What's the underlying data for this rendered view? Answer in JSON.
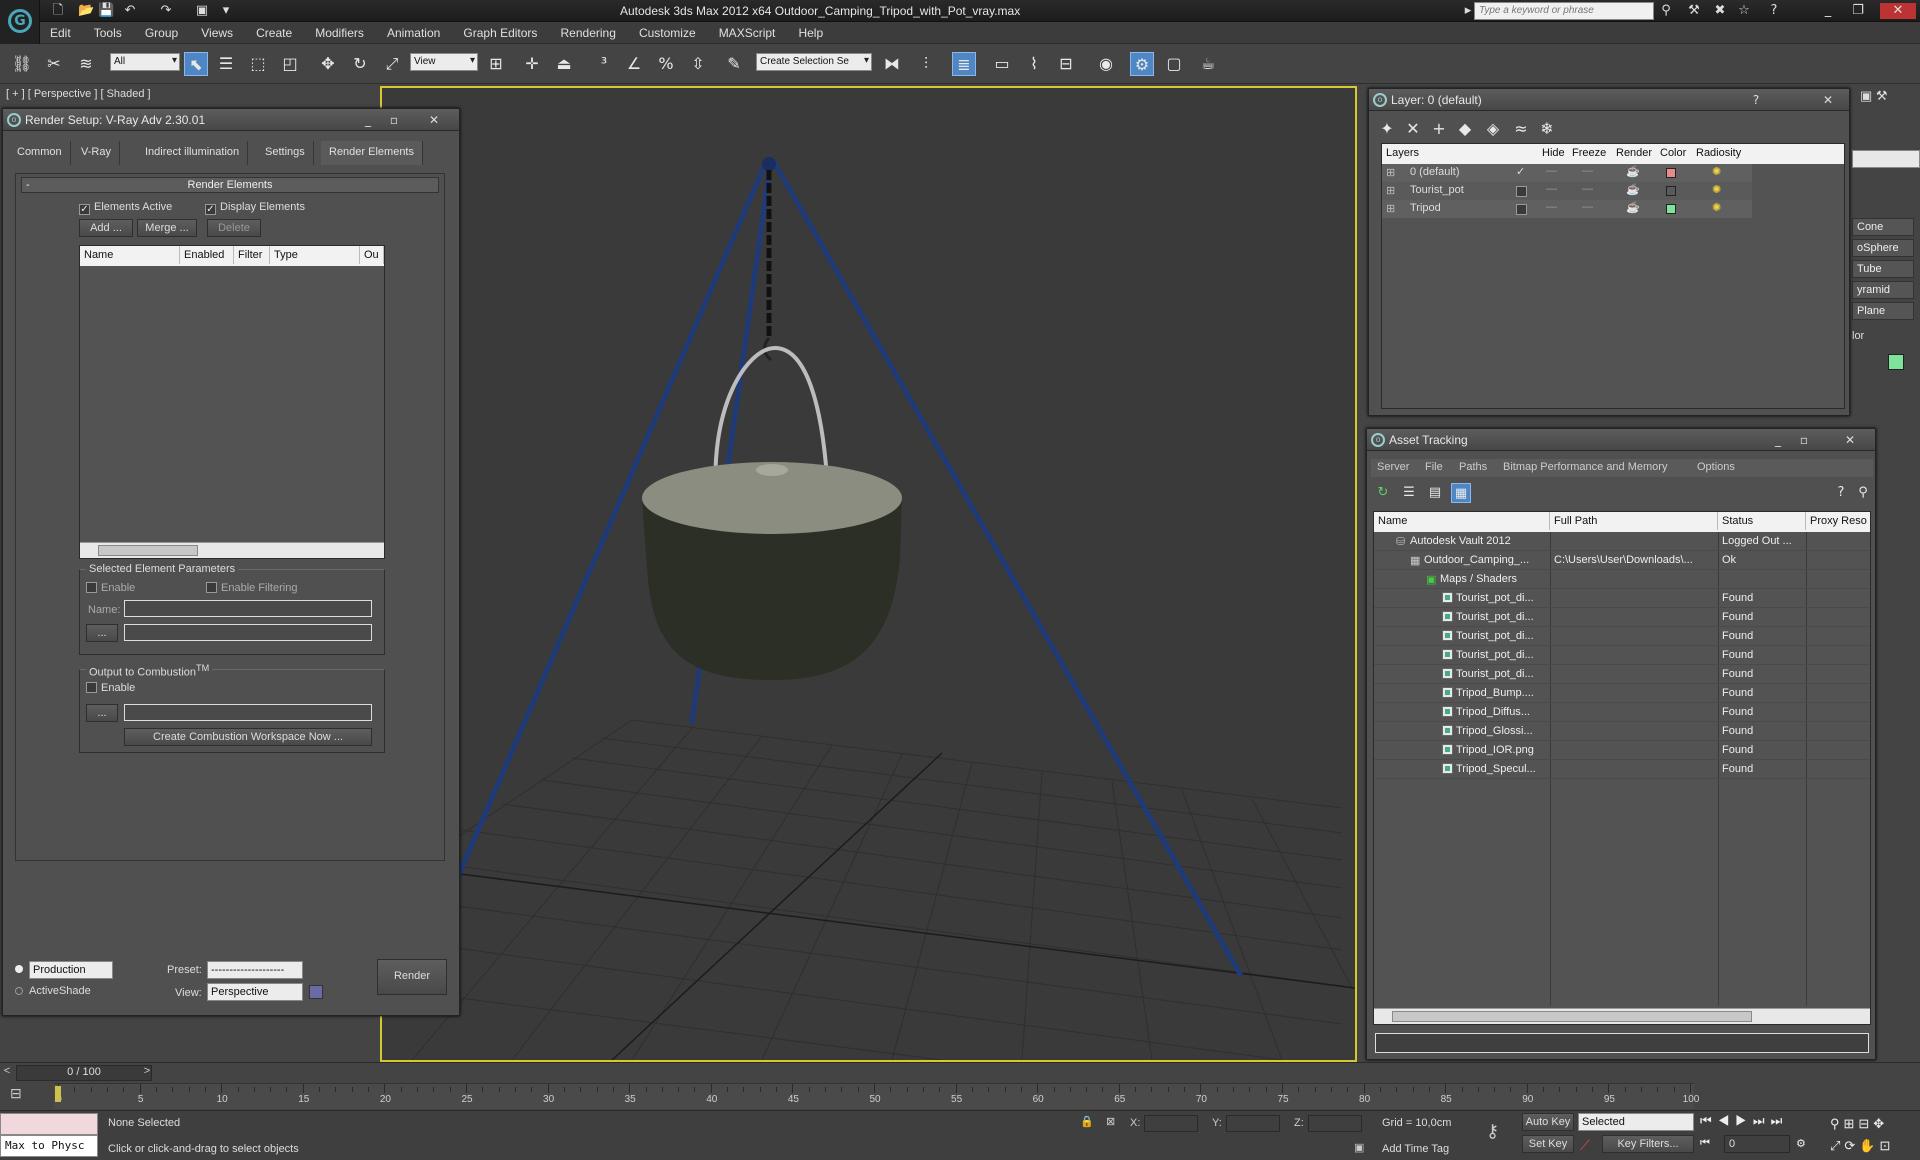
{
  "app": {
    "title": "Autodesk 3ds Max  2012 x64      Outdoor_Camping_Tripod_with_Pot_vray.max",
    "search_placeholder": "Type a keyword or phrase"
  },
  "menu": [
    "Edit",
    "Tools",
    "Group",
    "Views",
    "Create",
    "Modifiers",
    "Animation",
    "Graph Editors",
    "Rendering",
    "Customize",
    "MAXScript",
    "Help"
  ],
  "toolbar": {
    "selection_filter": "All",
    "ref_coord": "View",
    "named_selection": "Create Selection Se"
  },
  "viewport": {
    "label": "[ + ] [ Perspective ] [ Shaded ]"
  },
  "render_setup": {
    "title": "Render Setup: V-Ray Adv 2.30.01",
    "tabs": [
      "Common",
      "V-Ray",
      "Indirect illumination",
      "Settings",
      "Render Elements"
    ],
    "rollout": "Render Elements",
    "elements_active": "Elements Active",
    "display_elements": "Display Elements",
    "add": "Add ...",
    "merge": "Merge ...",
    "delete": "Delete",
    "columns": [
      "Name",
      "Enabled",
      "Filter",
      "Type",
      "Ou"
    ],
    "sel_params": "Selected Element Parameters",
    "enable": "Enable",
    "enable_filtering": "Enable Filtering",
    "name_label": "Name:",
    "dots": "...",
    "combustion": "Output to Combustion",
    "combustion_tm": "TM",
    "combustion_enable": "Enable",
    "create_workspace": "Create Combustion Workspace Now ...",
    "mode": "Production",
    "activeshade": "ActiveShade",
    "preset_label": "Preset:",
    "preset_value": "--------------------",
    "view_label": "View:",
    "view_value": "Perspective",
    "render_btn": "Render"
  },
  "layer": {
    "title": "Layer: 0 (default)",
    "columns": [
      "Layers",
      "Hide",
      "Freeze",
      "Render",
      "Color",
      "Radiosity"
    ],
    "rows": [
      {
        "name": "0 (default)",
        "current": "✓",
        "color": "#e88a8a"
      },
      {
        "name": "Tourist_pot",
        "current": "",
        "color": "#5a5a5a"
      },
      {
        "name": "Tripod",
        "current": "",
        "color": "#7ee39a"
      }
    ]
  },
  "asset": {
    "title": "Asset Tracking",
    "menu": [
      "Server",
      "File",
      "Paths",
      "Bitmap Performance and Memory",
      "Options"
    ],
    "columns": [
      "Name",
      "Full Path",
      "Status",
      "Proxy Reso"
    ],
    "rows": [
      {
        "name": "Autodesk Vault 2012",
        "path": "",
        "status": "Logged Out ..."
      },
      {
        "name": "Outdoor_Camping_...",
        "path": "C:\\Users\\User\\Downloads\\...",
        "status": "Ok"
      },
      {
        "name": "Maps / Shaders",
        "path": "",
        "status": ""
      },
      {
        "name": "Tourist_pot_di...",
        "path": "",
        "status": "Found"
      },
      {
        "name": "Tourist_pot_di...",
        "path": "",
        "status": "Found"
      },
      {
        "name": "Tourist_pot_di...",
        "path": "",
        "status": "Found"
      },
      {
        "name": "Tourist_pot_di...",
        "path": "",
        "status": "Found"
      },
      {
        "name": "Tourist_pot_di...",
        "path": "",
        "status": "Found"
      },
      {
        "name": "Tripod_Bump....",
        "path": "",
        "status": "Found"
      },
      {
        "name": "Tripod_Diffus...",
        "path": "",
        "status": "Found"
      },
      {
        "name": "Tripod_Glossi...",
        "path": "",
        "status": "Found"
      },
      {
        "name": "Tripod_IOR.png",
        "path": "",
        "status": "Found"
      },
      {
        "name": "Tripod_Specul...",
        "path": "",
        "status": "Found"
      }
    ]
  },
  "create_panel": {
    "items": [
      "Cone",
      "oSphere",
      "Tube",
      "yramid",
      "Plane"
    ],
    "color_label": "lor"
  },
  "timeline": {
    "frame": "0 / 100",
    "ticks": [
      "0",
      "5",
      "10",
      "15",
      "20",
      "25",
      "30",
      "35",
      "40",
      "45",
      "50",
      "55",
      "60",
      "65",
      "70",
      "75",
      "80",
      "85",
      "90",
      "95",
      "100"
    ]
  },
  "status": {
    "script_listener": "Max to Physc",
    "selection": "None Selected",
    "prompt": "Click or click-and-drag to select objects",
    "x": "X:",
    "y": "Y:",
    "z": "Z:",
    "grid": "Grid = 10,0cm",
    "add_time_tag": "Add Time Tag",
    "auto_key": "Auto Key",
    "set_key": "Set Key",
    "selected": "Selected",
    "key_filters": "Key Filters...",
    "frame_field": "0"
  }
}
